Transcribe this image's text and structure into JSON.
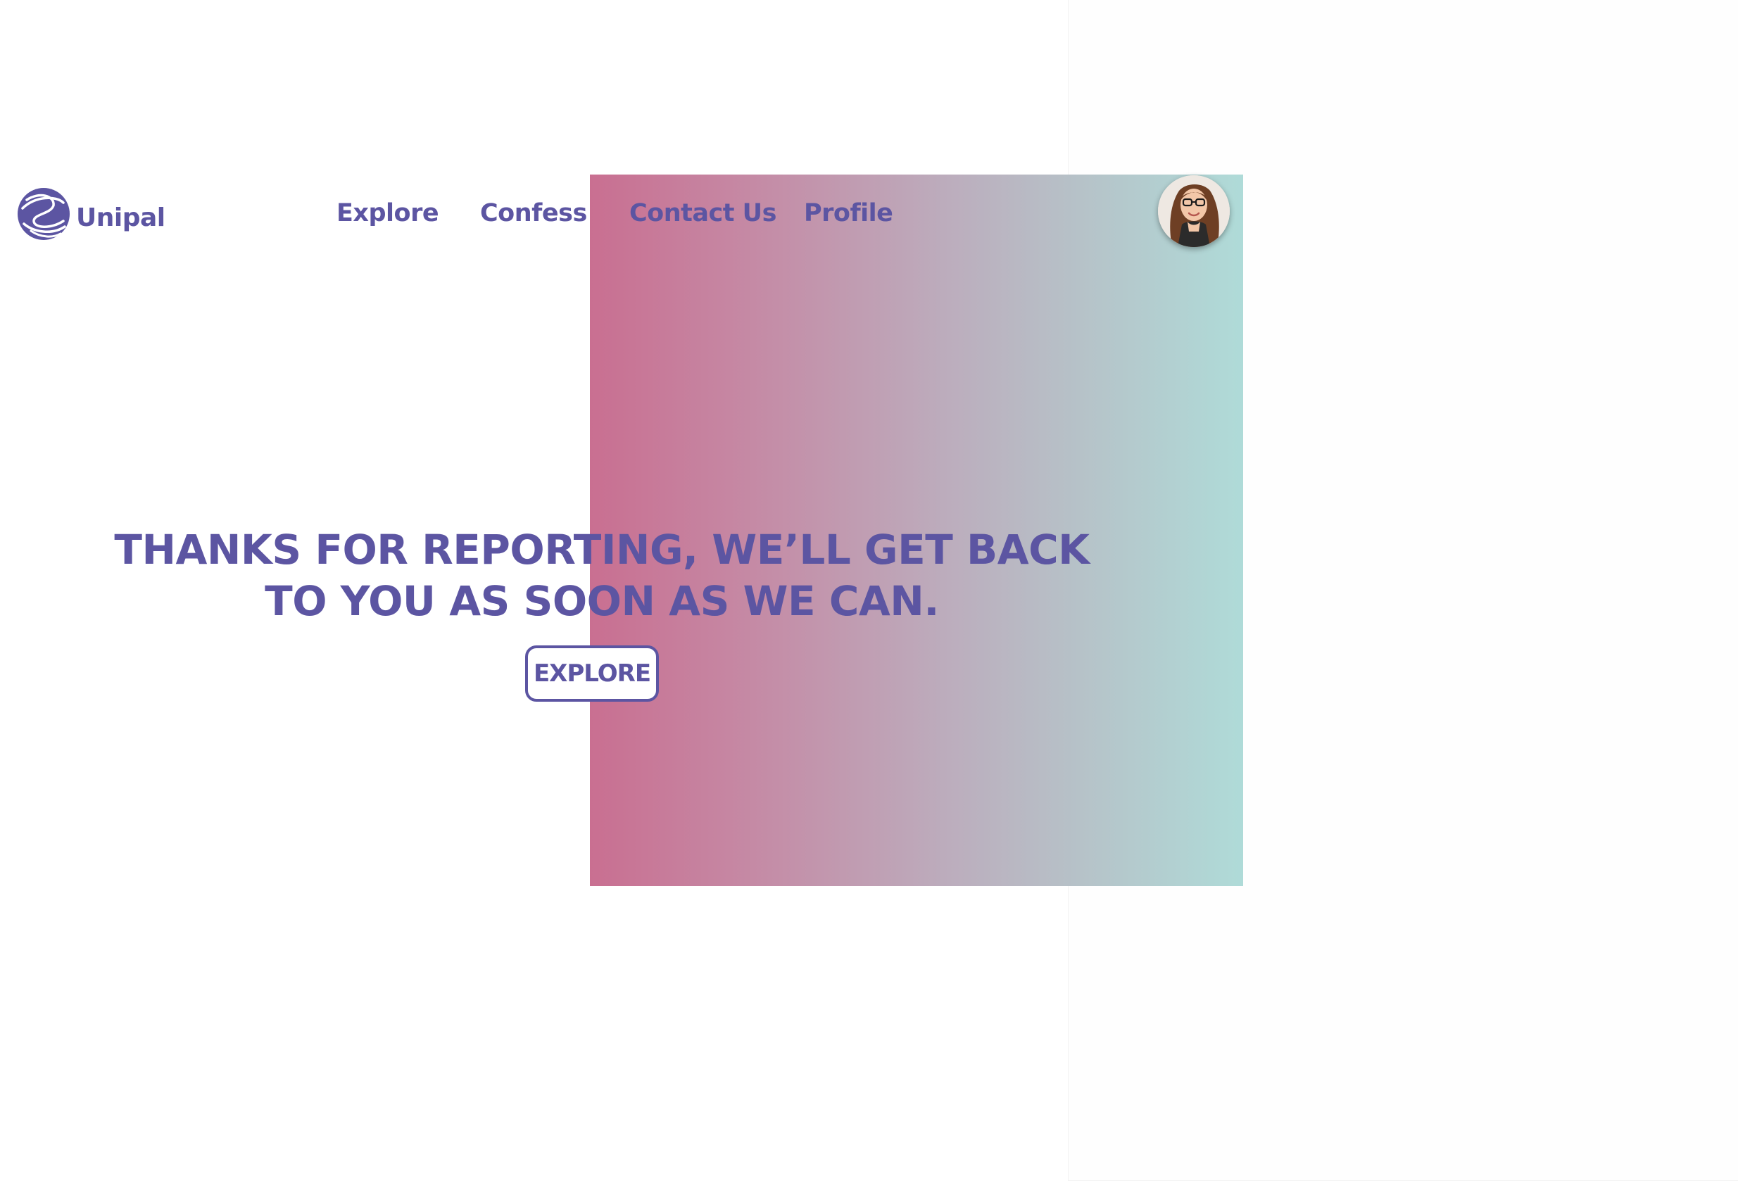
{
  "brand": {
    "name": "Unipal",
    "logo_icon": "globe-swirl-icon",
    "color": "#5c55a2"
  },
  "nav": {
    "items": [
      {
        "label": "Explore"
      },
      {
        "label": "Confess"
      },
      {
        "label": "Contact Us"
      },
      {
        "label": "Profile"
      }
    ]
  },
  "user": {
    "avatar_icon": "user-avatar-photo"
  },
  "hero": {
    "line1": "THANKS FOR REPORTING, WE’LL GET BACK",
    "line2": "TO YOU AS SOON AS WE CAN.",
    "button_label": "EXPLORE"
  },
  "colors": {
    "accent": "#5c55a2",
    "gradient_start": "#c96f91",
    "gradient_end": "#afdbd8",
    "background": "#ffffff"
  }
}
